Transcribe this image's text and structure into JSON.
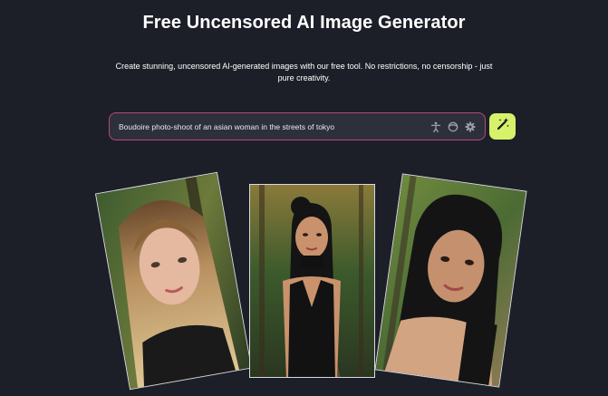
{
  "header": {
    "title": "Free Uncensored AI Image Generator",
    "subtitle": "Create stunning, uncensored AI-generated images with our free tool. No restrictions, no censorship - just pure creativity."
  },
  "prompt": {
    "value": "Boudoire photo-shoot of an asian woman in the streets of tokyo",
    "icons": [
      "pose-icon",
      "face-icon",
      "settings-gear-icon"
    ]
  },
  "generate_button": {
    "icon": "magic-wand-icon",
    "color": "#d6f16a"
  },
  "gallery": [
    {
      "subject": "blonde woman portrait in forest"
    },
    {
      "subject": "woman in black dress on forest path"
    },
    {
      "subject": "dark haired woman portrait in woodland"
    }
  ],
  "colors": {
    "background": "#1c1f28",
    "input_border": "#b8477a",
    "input_bg": "#2d303b",
    "accent": "#d6f16a"
  }
}
